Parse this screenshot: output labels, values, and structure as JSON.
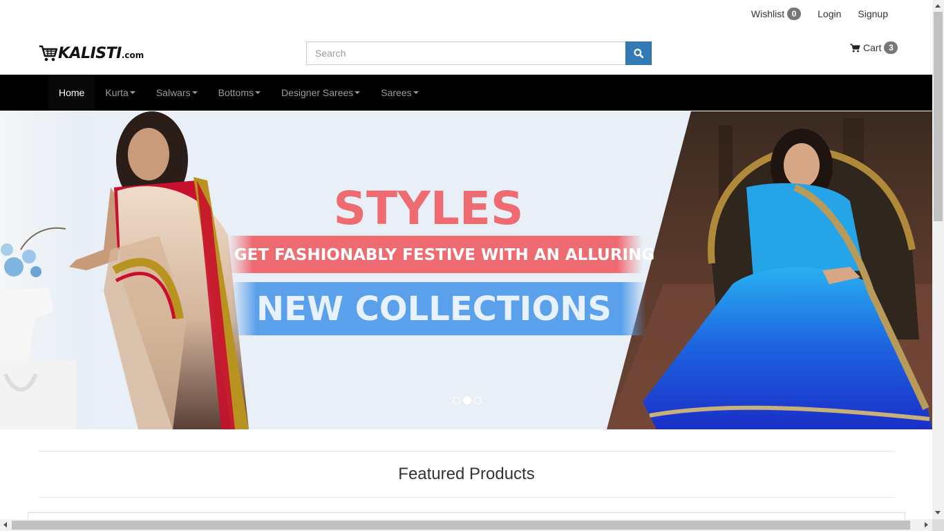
{
  "toplinks": {
    "wishlist_label": "Wishlist",
    "wishlist_count": "0",
    "login_label": "Login",
    "signup_label": "Signup"
  },
  "logo": {
    "name": "KALISTI",
    "suffix": ".com"
  },
  "search": {
    "placeholder": "Search",
    "value": ""
  },
  "cart": {
    "label": "Cart",
    "count": "3"
  },
  "nav": {
    "items": [
      {
        "label": "Home",
        "active": true,
        "dropdown": false
      },
      {
        "label": "Kurta",
        "dropdown": true
      },
      {
        "label": "Salwars",
        "dropdown": true
      },
      {
        "label": "Bottoms",
        "dropdown": true
      },
      {
        "label": "Designer Sarees",
        "dropdown": true
      },
      {
        "label": "Sarees",
        "dropdown": true
      }
    ]
  },
  "banner": {
    "headline": "STYLES",
    "tagline": "GET FASHIONABLY FESTIVE WITH AN ALLURING",
    "subline": "NEW COLLECTIONS",
    "slide_count": 3,
    "active_slide": 2
  },
  "featured": {
    "title": "Featured Products"
  },
  "colors": {
    "navbar_bg": "#000000",
    "search_button": "#337ab7",
    "headline_pink": "#ee6b72",
    "banner_blue": "#5ba0ea",
    "banner_bg": "#e9eff6",
    "saree_blue": "#1a3fd0",
    "saree_cream": "#e8cdb5",
    "saree_red": "#c8102e"
  },
  "icons": {
    "search": "search-icon",
    "cart": "cart-icon",
    "logo": "shopping-cart-logo-icon"
  }
}
